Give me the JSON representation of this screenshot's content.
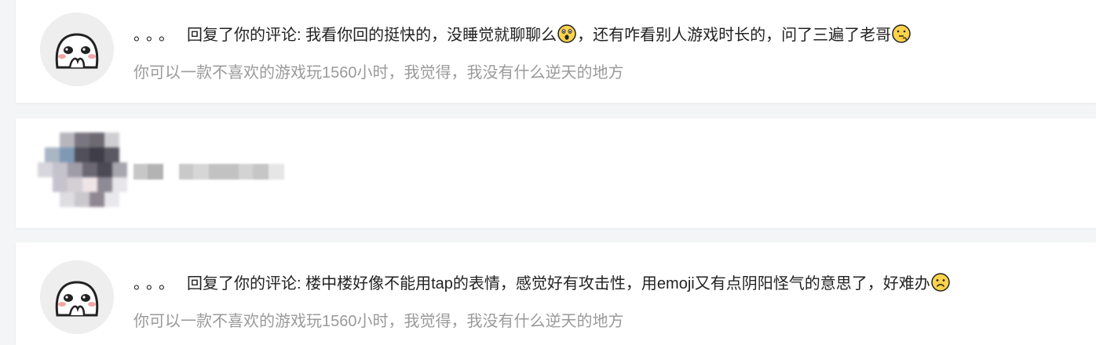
{
  "comments": [
    {
      "prefix": "。。。",
      "reply_text": "回复了你的评论: 我看你回的挺快的，没睡觉就聊聊么",
      "reply_text_2": "，还有咋看别人游戏时长的，问了三遍了老哥",
      "emoji_1": "surprised-face-icon",
      "emoji_2": "thinking-face-icon",
      "quote": "你可以一款不喜欢的游戏玩1560小时，我觉得，我没有什么逆天的地方"
    },
    {
      "redacted": true
    },
    {
      "prefix": "。。。",
      "reply_text": "回复了你的评论: 楼中楼好像不能用tap的表情，感觉好有攻击性，用emoji又有点阴阳怪气的意思了，好难办",
      "emoji_1": "frowning-face-icon",
      "quote": "你可以一款不喜欢的游戏玩1560小时，我觉得，我没有什么逆天的地方"
    }
  ],
  "colors": {
    "background": "#f4f5f7",
    "card": "#ffffff",
    "text_primary": "#222222",
    "text_secondary": "#9a9a9a"
  }
}
